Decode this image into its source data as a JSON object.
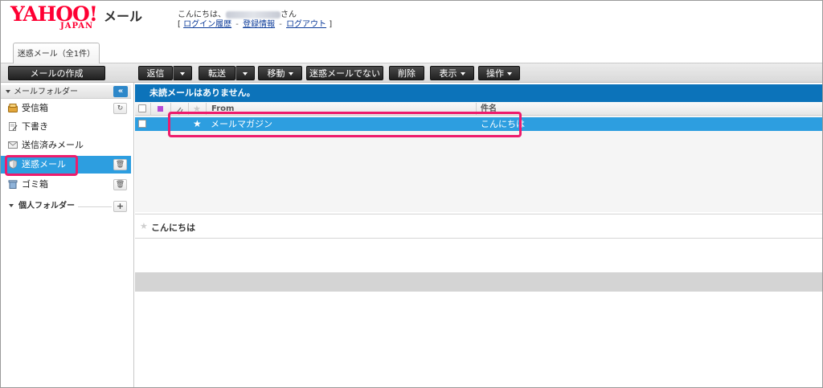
{
  "header": {
    "logo_main": "YAHOO!",
    "logo_sub": "JAPAN",
    "app_name": "メール",
    "greeting_prefix": "こんにちは、",
    "greeting_suffix": "さん",
    "links": {
      "open_bracket": "[",
      "close_bracket": "]",
      "separator": "-",
      "login_history": "ログイン履歴",
      "account_info": "登録情報",
      "logout": "ログアウト"
    }
  },
  "tabs": [
    {
      "label": "迷惑メール（全1件）"
    }
  ],
  "toolbar": {
    "compose": "メールの作成",
    "reply": "返信",
    "forward": "転送",
    "move": "移動",
    "not_spam": "迷惑メールでない",
    "delete": "削除",
    "view": "表示",
    "actions": "操作"
  },
  "sidebar": {
    "folder_header": "メールフォルダー",
    "collapse_symbol": "«",
    "items": [
      {
        "label": "受信箱",
        "icon": "inbox-icon",
        "button": "↻"
      },
      {
        "label": "下書き",
        "icon": "draft-icon"
      },
      {
        "label": "送信済みメール",
        "icon": "sent-icon"
      },
      {
        "label": "迷惑メール",
        "icon": "shield-icon",
        "button": "🗑",
        "selected": true
      },
      {
        "label": "ゴミ箱",
        "icon": "trash-icon",
        "button": "🗑"
      }
    ],
    "personal_folder": "個人フォルダー",
    "add_symbol": "+"
  },
  "main": {
    "banner": "未読メールはありません。",
    "columns": {
      "from": "From",
      "subject": "件名"
    },
    "messages": [
      {
        "from": "メールマガジン",
        "subject": "こんにちは",
        "starred": true,
        "selected": true
      }
    ],
    "preview_subject": "こんにちは"
  },
  "colors": {
    "accent_blue": "#2d9ee0",
    "banner_blue": "#0c73ba",
    "highlight_pink": "#ee1b6c",
    "logo_red": "#ff0033"
  }
}
